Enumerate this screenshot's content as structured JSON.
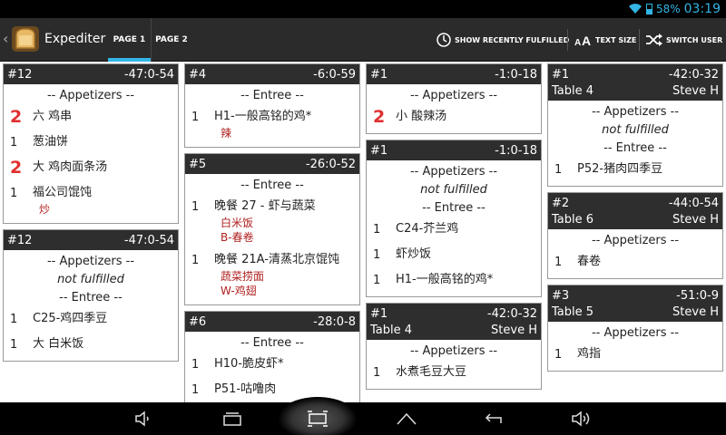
{
  "status": {
    "battery": "58%",
    "time": "03:19"
  },
  "app": {
    "title": "Expediter"
  },
  "tabs": [
    {
      "label": "PAGE 1"
    },
    {
      "label": "PAGE 2"
    }
  ],
  "actions": {
    "recent": "SHOW RECENTLY FULFILLED",
    "text_size": "TEXT SIZE",
    "switch_user": "SWITCH USER"
  },
  "colors": {
    "accent": "#33b5e5",
    "header": "#2e2e2e",
    "modifier": "#b02020",
    "qty_highlight": "#e03030"
  },
  "columns": [
    [
      {
        "id": "#12",
        "time": "-47:0-54",
        "lines": [
          {
            "kind": "course",
            "text": "-- Appetizers --"
          },
          {
            "kind": "item",
            "qty": "2",
            "big": true,
            "name": "六 鸡串"
          },
          {
            "kind": "item",
            "qty": "1",
            "name": "葱油饼"
          },
          {
            "kind": "item",
            "qty": "2",
            "big": true,
            "name": "大 鸡肉面条汤"
          },
          {
            "kind": "item",
            "qty": "1",
            "name": "福公司馄饨",
            "mods": [
              "炒"
            ]
          }
        ]
      },
      {
        "id": "#12",
        "time": "-47:0-54",
        "lines": [
          {
            "kind": "course",
            "text": "-- Appetizers --"
          },
          {
            "kind": "nf",
            "text": "not fulfilled"
          },
          {
            "kind": "course",
            "text": "-- Entree --"
          },
          {
            "kind": "item",
            "qty": "1",
            "name": "C25-鸡四季豆"
          },
          {
            "kind": "item",
            "qty": "1",
            "name": "大 白米饭"
          }
        ]
      }
    ],
    [
      {
        "id": "#4",
        "time": "-6:0-59",
        "lines": [
          {
            "kind": "course",
            "text": "-- Entree --"
          },
          {
            "kind": "item",
            "qty": "1",
            "name": "H1-一般高铭的鸡*",
            "mods": [
              "辣"
            ]
          }
        ]
      },
      {
        "id": "#5",
        "time": "-26:0-52",
        "lines": [
          {
            "kind": "course",
            "text": "-- Entree --"
          },
          {
            "kind": "item",
            "qty": "1",
            "name": "晚餐 27 - 虾与蔬菜",
            "mods": [
              "白米饭",
              "B-春卷"
            ]
          },
          {
            "kind": "item",
            "qty": "1",
            "name": "晚餐 21A-清蒸北京馄饨",
            "mods": [
              "蔬菜捞面",
              "W-鸡翅"
            ]
          }
        ]
      },
      {
        "id": "#6",
        "time": "-28:0-8",
        "lines": [
          {
            "kind": "course",
            "text": "-- Entree --"
          },
          {
            "kind": "item",
            "qty": "1",
            "name": "H10-脆皮虾*"
          },
          {
            "kind": "item",
            "qty": "1",
            "name": "P51-咕噜肉"
          }
        ]
      }
    ],
    [
      {
        "id": "#1",
        "time": "-1:0-18",
        "lines": [
          {
            "kind": "course",
            "text": "-- Appetizers --"
          },
          {
            "kind": "item",
            "qty": "2",
            "big": true,
            "name": "小 酸辣汤"
          }
        ]
      },
      {
        "id": "#1",
        "time": "-1:0-18",
        "lines": [
          {
            "kind": "course",
            "text": "-- Appetizers --"
          },
          {
            "kind": "nf",
            "text": "not fulfilled"
          },
          {
            "kind": "course",
            "text": "-- Entree --"
          },
          {
            "kind": "item",
            "qty": "1",
            "name": "C24-芥兰鸡"
          },
          {
            "kind": "item",
            "qty": "1",
            "name": "虾炒饭"
          },
          {
            "kind": "item",
            "qty": "1",
            "name": "H1-一般高铭的鸡*"
          }
        ]
      },
      {
        "id": "#1",
        "time": "-42:0-32",
        "table": "Table 4",
        "server": "Steve H",
        "lines": [
          {
            "kind": "course",
            "text": "-- Appetizers --"
          },
          {
            "kind": "item",
            "qty": "1",
            "name": "水煮毛豆大豆"
          }
        ]
      }
    ],
    [
      {
        "id": "#1",
        "time": "-42:0-32",
        "table": "Table 4",
        "server": "Steve H",
        "lines": [
          {
            "kind": "course",
            "text": "-- Appetizers --"
          },
          {
            "kind": "nf",
            "text": "not fulfilled"
          },
          {
            "kind": "course",
            "text": "-- Entree --"
          },
          {
            "kind": "item",
            "qty": "1",
            "name": "P52-猪肉四季豆"
          }
        ]
      },
      {
        "id": "#2",
        "time": "-44:0-54",
        "table": "Table 6",
        "server": "Steve H",
        "lines": [
          {
            "kind": "course",
            "text": "-- Appetizers --"
          },
          {
            "kind": "item",
            "qty": "1",
            "name": "春卷"
          }
        ]
      },
      {
        "id": "#3",
        "time": "-51:0-9",
        "table": "Table 5",
        "server": "Steve H",
        "lines": [
          {
            "kind": "course",
            "text": "-- Appetizers --"
          },
          {
            "kind": "item",
            "qty": "1",
            "name": "鸡指"
          }
        ]
      }
    ]
  ],
  "navbar": {
    "icons": [
      "volume-down-icon",
      "back-window-icon",
      "recent-apps-icon",
      "home-icon",
      "back-icon",
      "volume-up-icon"
    ]
  }
}
